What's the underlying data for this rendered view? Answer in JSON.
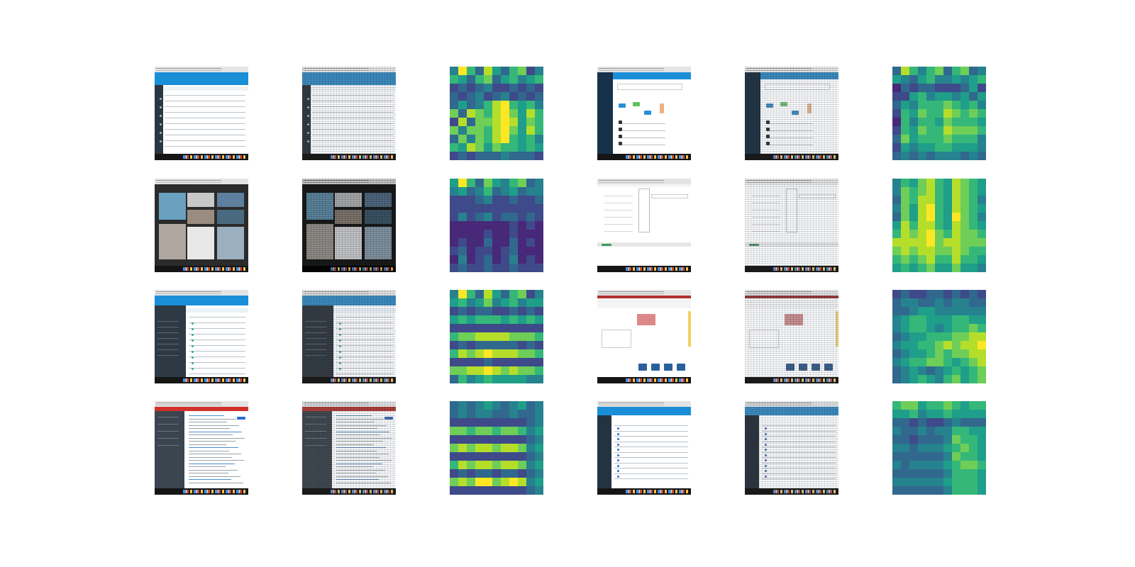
{
  "layout": {
    "rows": 4,
    "columns": 6
  },
  "palette": [
    "#440154",
    "#482878",
    "#3e4a89",
    "#31688e",
    "#26828e",
    "#1f9e89",
    "#35b779",
    "#6ece58",
    "#b5de2b",
    "#fde725"
  ],
  "rows": [
    {
      "left": {
        "screenshot": "dashboard-table-blue",
        "heatmap": [
          [
            4,
            9,
            6,
            3,
            8,
            5,
            3,
            6,
            7,
            2,
            4
          ],
          [
            6,
            5,
            3,
            6,
            7,
            3,
            5,
            6,
            4,
            5,
            6
          ],
          [
            2,
            3,
            2,
            3,
            4,
            2,
            2,
            3,
            2,
            3,
            2
          ],
          [
            3,
            2,
            3,
            4,
            2,
            3,
            4,
            2,
            3,
            2,
            3
          ],
          [
            3,
            5,
            3,
            4,
            6,
            8,
            9,
            6,
            5,
            6,
            4
          ],
          [
            7,
            3,
            8,
            7,
            6,
            8,
            9,
            7,
            5,
            8,
            6
          ],
          [
            2,
            8,
            3,
            7,
            7,
            8,
            9,
            8,
            5,
            7,
            6
          ],
          [
            7,
            4,
            7,
            7,
            6,
            8,
            9,
            7,
            5,
            8,
            6
          ],
          [
            3,
            7,
            4,
            7,
            6,
            8,
            9,
            6,
            5,
            6,
            4
          ],
          [
            6,
            5,
            8,
            7,
            5,
            7,
            6,
            6,
            5,
            6,
            5
          ],
          [
            2,
            3,
            2,
            3,
            3,
            3,
            4,
            3,
            3,
            3,
            2
          ]
        ]
      },
      "right": {
        "screenshot": "app-dashboard-cards",
        "heatmap": [
          [
            3,
            8,
            6,
            4,
            6,
            7,
            3,
            6,
            7,
            3,
            4
          ],
          [
            5,
            4,
            3,
            5,
            6,
            4,
            4,
            5,
            4,
            5,
            6
          ],
          [
            1,
            3,
            2,
            3,
            3,
            2,
            2,
            2,
            3,
            5,
            2
          ],
          [
            2,
            2,
            5,
            6,
            4,
            5,
            5,
            4,
            5,
            3,
            5
          ],
          [
            3,
            5,
            4,
            6,
            6,
            6,
            7,
            6,
            5,
            6,
            4
          ],
          [
            2,
            6,
            5,
            7,
            6,
            6,
            8,
            7,
            6,
            7,
            6
          ],
          [
            1,
            6,
            4,
            6,
            6,
            5,
            7,
            6,
            6,
            6,
            5
          ],
          [
            2,
            6,
            5,
            7,
            6,
            6,
            8,
            7,
            7,
            7,
            6
          ],
          [
            3,
            7,
            5,
            6,
            6,
            6,
            7,
            6,
            6,
            6,
            4
          ],
          [
            2,
            5,
            4,
            5,
            5,
            6,
            6,
            5,
            5,
            5,
            4
          ],
          [
            3,
            4,
            3,
            4,
            3,
            4,
            4,
            4,
            3,
            4,
            3
          ]
        ]
      }
    },
    {
      "left": {
        "screenshot": "image-gallery-dark",
        "heatmap": [
          [
            5,
            9,
            6,
            3,
            7,
            5,
            4,
            6,
            7,
            3,
            4
          ],
          [
            4,
            5,
            3,
            4,
            6,
            3,
            4,
            5,
            3,
            4,
            4
          ],
          [
            2,
            2,
            2,
            3,
            4,
            2,
            2,
            3,
            2,
            2,
            3
          ],
          [
            2,
            2,
            2,
            2,
            2,
            2,
            2,
            2,
            2,
            2,
            2
          ],
          [
            2,
            4,
            2,
            3,
            4,
            2,
            3,
            3,
            2,
            3,
            2
          ],
          [
            1,
            1,
            1,
            1,
            1,
            1,
            1,
            2,
            1,
            2,
            1
          ],
          [
            1,
            1,
            1,
            1,
            2,
            1,
            1,
            2,
            1,
            1,
            1
          ],
          [
            1,
            2,
            1,
            1,
            3,
            1,
            1,
            3,
            1,
            2,
            1
          ],
          [
            2,
            3,
            1,
            2,
            2,
            1,
            2,
            3,
            1,
            1,
            1
          ],
          [
            1,
            4,
            1,
            2,
            3,
            1,
            2,
            4,
            1,
            2,
            1
          ],
          [
            2,
            3,
            2,
            2,
            3,
            2,
            2,
            3,
            2,
            2,
            2
          ]
        ]
      },
      "right": {
        "screenshot": "form-dropdown-white",
        "heatmap": [
          [
            4,
            6,
            5,
            7,
            8,
            6,
            5,
            8,
            7,
            6,
            5
          ],
          [
            4,
            7,
            6,
            7,
            8,
            6,
            5,
            8,
            7,
            6,
            5
          ],
          [
            3,
            7,
            6,
            8,
            8,
            6,
            5,
            8,
            7,
            6,
            4
          ],
          [
            4,
            7,
            5,
            8,
            9,
            6,
            5,
            8,
            7,
            6,
            5
          ],
          [
            3,
            7,
            5,
            8,
            9,
            6,
            5,
            9,
            7,
            6,
            4
          ],
          [
            5,
            8,
            6,
            8,
            8,
            6,
            5,
            8,
            7,
            6,
            5
          ],
          [
            6,
            8,
            7,
            8,
            9,
            7,
            6,
            8,
            7,
            7,
            6
          ],
          [
            8,
            8,
            8,
            8,
            9,
            7,
            8,
            8,
            7,
            7,
            7
          ],
          [
            7,
            8,
            7,
            8,
            8,
            7,
            7,
            8,
            7,
            6,
            6
          ],
          [
            6,
            7,
            6,
            7,
            8,
            6,
            6,
            8,
            6,
            6,
            5
          ],
          [
            5,
            6,
            5,
            6,
            7,
            5,
            5,
            7,
            5,
            5,
            4
          ]
        ]
      }
    },
    {
      "left": {
        "screenshot": "list-view-sidebar",
        "heatmap": [
          [
            4,
            9,
            6,
            3,
            8,
            5,
            3,
            6,
            7,
            2,
            4
          ],
          [
            5,
            6,
            4,
            5,
            7,
            4,
            5,
            6,
            4,
            5,
            5
          ],
          [
            2,
            3,
            2,
            3,
            3,
            2,
            2,
            3,
            2,
            3,
            2
          ],
          [
            5,
            6,
            5,
            6,
            6,
            6,
            5,
            6,
            5,
            6,
            5
          ],
          [
            2,
            2,
            2,
            2,
            2,
            2,
            2,
            2,
            2,
            2,
            2
          ],
          [
            6,
            7,
            7,
            8,
            8,
            8,
            8,
            7,
            7,
            7,
            6
          ],
          [
            2,
            3,
            2,
            3,
            3,
            3,
            3,
            3,
            2,
            3,
            2
          ],
          [
            6,
            8,
            7,
            8,
            9,
            8,
            8,
            8,
            7,
            7,
            6
          ],
          [
            2,
            2,
            2,
            2,
            3,
            2,
            2,
            2,
            2,
            2,
            2
          ],
          [
            7,
            7,
            8,
            8,
            9,
            8,
            7,
            8,
            7,
            7,
            6
          ],
          [
            3,
            6,
            4,
            5,
            6,
            5,
            5,
            5,
            5,
            4,
            4
          ]
        ]
      },
      "right": {
        "screenshot": "storefront-white",
        "heatmap": [
          [
            2,
            3,
            2,
            2,
            3,
            3,
            2,
            3,
            2,
            3,
            2
          ],
          [
            3,
            4,
            4,
            3,
            3,
            4,
            3,
            4,
            4,
            3,
            3
          ],
          [
            3,
            3,
            4,
            5,
            5,
            4,
            4,
            4,
            4,
            4,
            4
          ],
          [
            4,
            5,
            6,
            6,
            5,
            5,
            5,
            6,
            6,
            5,
            5
          ],
          [
            4,
            5,
            6,
            6,
            5,
            4,
            5,
            6,
            6,
            7,
            6
          ],
          [
            3,
            4,
            5,
            5,
            6,
            6,
            6,
            7,
            7,
            8,
            8
          ],
          [
            4,
            5,
            5,
            6,
            6,
            7,
            8,
            7,
            8,
            8,
            9
          ],
          [
            3,
            4,
            5,
            5,
            6,
            7,
            6,
            7,
            7,
            8,
            8
          ],
          [
            4,
            5,
            6,
            6,
            7,
            7,
            6,
            5,
            6,
            7,
            8
          ],
          [
            3,
            4,
            5,
            4,
            3,
            4,
            5,
            6,
            5,
            6,
            7
          ],
          [
            3,
            4,
            5,
            6,
            5,
            4,
            6,
            7,
            5,
            6,
            7
          ]
        ]
      }
    },
    {
      "left": {
        "screenshot": "document-red-header",
        "heatmap": [
          [
            3,
            4,
            3,
            4,
            5,
            4,
            3,
            4,
            5,
            3,
            4
          ],
          [
            3,
            4,
            3,
            4,
            4,
            3,
            3,
            4,
            3,
            3,
            4
          ],
          [
            2,
            2,
            2,
            2,
            2,
            2,
            2,
            2,
            2,
            3,
            4
          ],
          [
            7,
            7,
            6,
            7,
            7,
            6,
            7,
            7,
            6,
            4,
            5
          ],
          [
            2,
            2,
            2,
            2,
            2,
            2,
            2,
            2,
            2,
            3,
            4
          ],
          [
            7,
            8,
            7,
            8,
            8,
            7,
            8,
            8,
            7,
            4,
            5
          ],
          [
            2,
            2,
            2,
            2,
            2,
            2,
            2,
            2,
            2,
            3,
            4
          ],
          [
            6,
            8,
            7,
            8,
            8,
            7,
            8,
            8,
            7,
            4,
            5
          ],
          [
            2,
            3,
            2,
            3,
            3,
            2,
            3,
            3,
            2,
            3,
            4
          ],
          [
            7,
            8,
            7,
            9,
            9,
            7,
            8,
            9,
            8,
            4,
            5
          ],
          [
            2,
            2,
            2,
            2,
            2,
            2,
            2,
            2,
            2,
            3,
            4
          ]
        ]
      },
      "right": {
        "screenshot": "table-list-blue",
        "heatmap": [
          [
            6,
            7,
            7,
            5,
            6,
            6,
            7,
            6,
            5,
            6,
            6
          ],
          [
            5,
            5,
            6,
            4,
            5,
            5,
            6,
            5,
            5,
            5,
            5
          ],
          [
            3,
            3,
            2,
            3,
            2,
            2,
            3,
            4,
            3,
            3,
            3
          ],
          [
            4,
            3,
            3,
            4,
            3,
            4,
            4,
            6,
            6,
            5,
            5
          ],
          [
            3,
            3,
            2,
            3,
            3,
            3,
            4,
            7,
            6,
            6,
            5
          ],
          [
            4,
            4,
            3,
            4,
            4,
            4,
            5,
            6,
            7,
            6,
            5
          ],
          [
            3,
            3,
            3,
            3,
            3,
            3,
            4,
            7,
            6,
            6,
            5
          ],
          [
            4,
            3,
            4,
            4,
            4,
            4,
            5,
            6,
            7,
            7,
            6
          ],
          [
            3,
            3,
            3,
            3,
            3,
            3,
            4,
            6,
            6,
            6,
            5
          ],
          [
            4,
            4,
            4,
            4,
            4,
            4,
            5,
            6,
            6,
            6,
            5
          ],
          [
            3,
            3,
            3,
            3,
            3,
            3,
            4,
            6,
            6,
            6,
            5
          ]
        ]
      }
    }
  ]
}
